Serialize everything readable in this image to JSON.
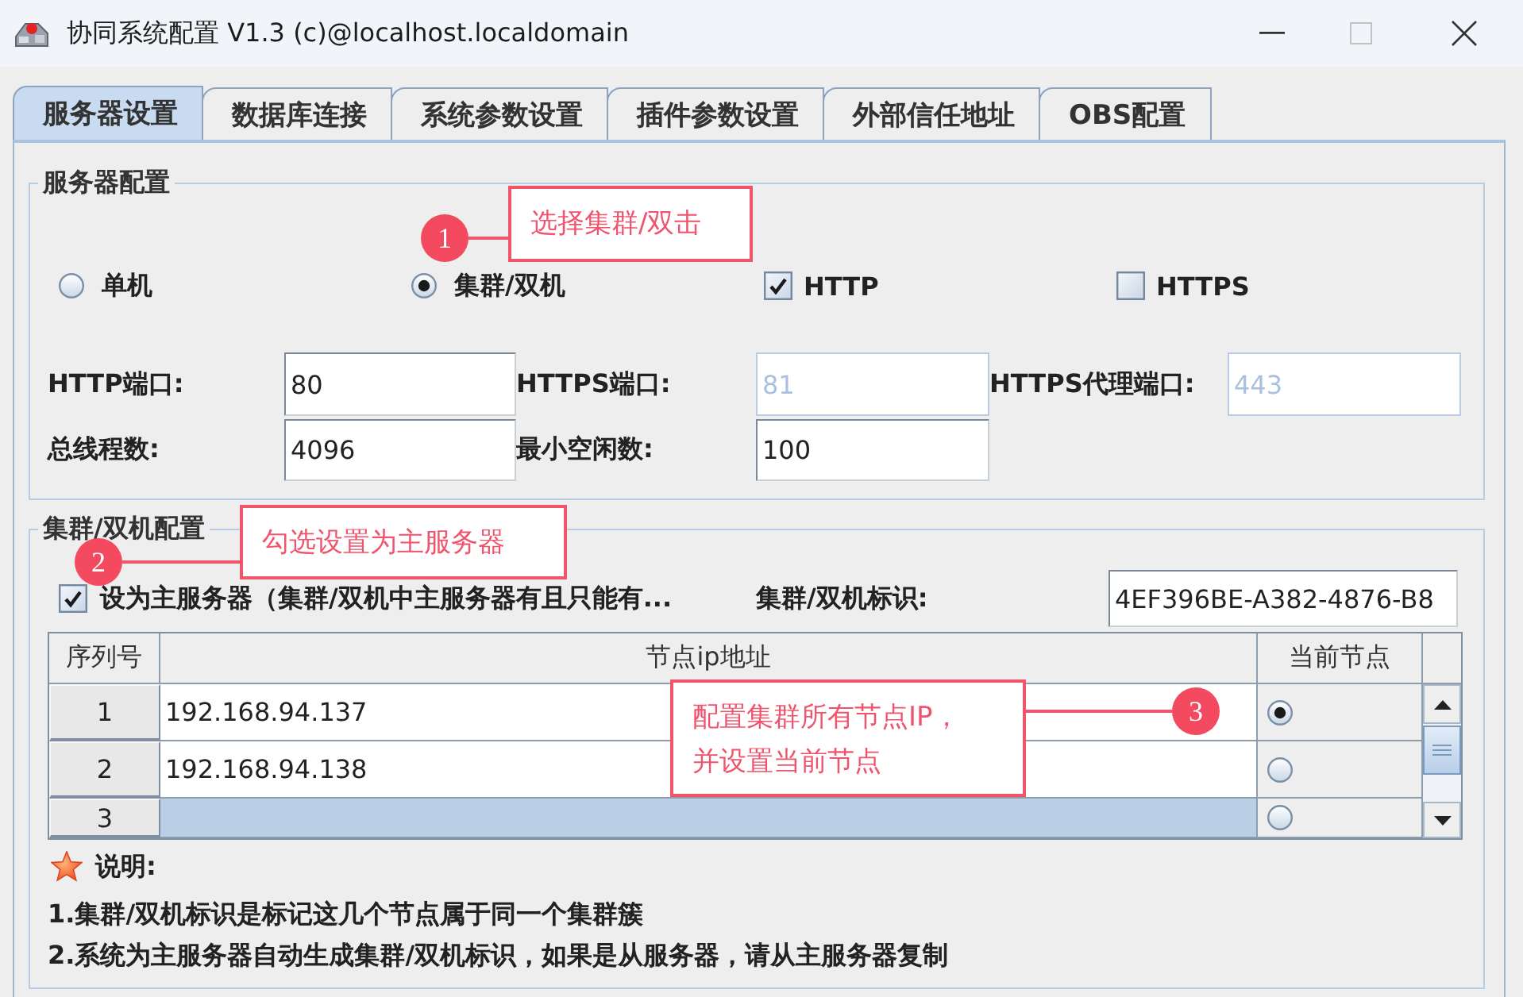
{
  "window": {
    "title": "协同系统配置 V1.3 (c)@localhost.localdomain"
  },
  "tabs": [
    {
      "label": "服务器设置",
      "selected": true
    },
    {
      "label": "数据库连接",
      "selected": false
    },
    {
      "label": "系统参数设置",
      "selected": false
    },
    {
      "label": "插件参数设置",
      "selected": false
    },
    {
      "label": "外部信任地址",
      "selected": false
    },
    {
      "label": "OBS配置",
      "selected": false
    }
  ],
  "server_config": {
    "title": "服务器配置",
    "modes": [
      {
        "label": "单机",
        "selected": false
      },
      {
        "label": "集群/双机",
        "selected": true
      }
    ],
    "protocols": [
      {
        "label": "HTTP",
        "checked": true
      },
      {
        "label": "HTTPS",
        "checked": false
      }
    ],
    "fields": [
      {
        "label": "HTTP端口:",
        "value": "80",
        "disabled": false
      },
      {
        "label": "HTTPS端口:",
        "value": "81",
        "disabled": true
      },
      {
        "label": "HTTPS代理端口:",
        "value": "443",
        "disabled": true
      },
      {
        "label": "总线程数:",
        "value": "4096",
        "disabled": false
      },
      {
        "label": "最小空闲数:",
        "value": "100",
        "disabled": false
      }
    ]
  },
  "cluster_config": {
    "title": "集群/双机配置",
    "master": {
      "label": "设为主服务器（集群/双机中主服务器有且只能有...",
      "checked": true
    },
    "cluster_id": {
      "label": "集群/双机标识:",
      "value": "4EF396BE-A382-4876-B8"
    },
    "table": {
      "columns": [
        "序列号",
        "节点ip地址",
        "当前节点"
      ],
      "rows": [
        {
          "index": "1",
          "ip": "192.168.94.137",
          "current": true,
          "selected": false
        },
        {
          "index": "2",
          "ip": "192.168.94.138",
          "current": false,
          "selected": false
        },
        {
          "index": "3",
          "ip": "",
          "current": false,
          "selected": true
        }
      ]
    }
  },
  "notes": {
    "title": "说明:",
    "lines": [
      "1.集群/双机标识是标记这几个节点属于同一个集群簇",
      "2.系统为主服务器自动生成集群/双机标识，如果是从服务器，请从主服务器复制"
    ]
  },
  "annotations": [
    {
      "number": "1",
      "lines": [
        "选择集群/双击"
      ]
    },
    {
      "number": "2",
      "lines": [
        "勾选设置为主服务器"
      ]
    },
    {
      "number": "3",
      "lines": [
        "配置集群所有节点IP，",
        "并设置当前节点"
      ]
    }
  ]
}
